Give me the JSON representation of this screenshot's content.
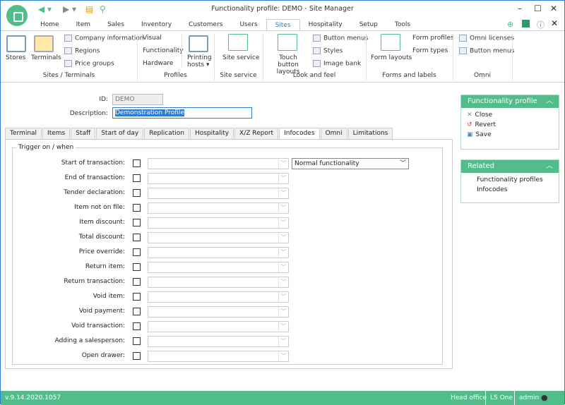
{
  "window": {
    "title": "Functionality profile: DEMO - Site Manager"
  },
  "menu_tabs": [
    "Home",
    "Item",
    "Sales",
    "Inventory",
    "Customers",
    "Users",
    "Sites",
    "Hospitality",
    "Setup",
    "Tools"
  ],
  "active_tab": "Sites",
  "ribbon": {
    "sites_terminals": {
      "label": "Sites / Terminals",
      "stores": "Stores",
      "terminals": "Terminals",
      "company": "Company information",
      "regions": "Regions",
      "price_groups": "Price groups"
    },
    "profiles": {
      "label": "Profiles",
      "visual": "Visual",
      "functionality": "Functionality",
      "hardware": "Hardware",
      "printing_hosts": "Printing hosts"
    },
    "site_service": {
      "label": "Site service",
      "site_service": "Site service"
    },
    "look_feel": {
      "label": "Look and feel",
      "touch": "Touch button layouts",
      "button_menus": "Button menus",
      "styles": "Styles",
      "image_bank": "Image bank"
    },
    "forms": {
      "label": "Forms and labels",
      "form_layouts": "Form layouts",
      "form_profiles": "Form profiles",
      "form_types": "Form types"
    },
    "omni": {
      "label": "Omni",
      "licenses": "Omni licenses",
      "button_menus": "Button menus"
    }
  },
  "form": {
    "id_label": "ID:",
    "id_value": "DEMO",
    "desc_label": "Description:",
    "desc_value": "Demonstration Profile"
  },
  "page_tabs": [
    "Terminal",
    "Items",
    "Staff",
    "Start of day",
    "Replication",
    "Hospitality",
    "X/Z Report",
    "Infocodes",
    "Omni",
    "Limitations"
  ],
  "active_page_tab": "Infocodes",
  "group_title": "Trigger on / when",
  "triggers": [
    "Start of transaction:",
    "End of transaction:",
    "Tender declaration:",
    "Item not on file:",
    "Item discount:",
    "Total discount:",
    "Price override:",
    "Return item:",
    "Return transaction:",
    "Void item:",
    "Void payment:",
    "Void transaction:",
    "Adding a salesperson:",
    "Open drawer:"
  ],
  "start_mode": "Normal functionality",
  "side": {
    "profile_title": "Functionality profile",
    "close": "Close",
    "revert": "Revert",
    "save": "Save",
    "related_title": "Related",
    "related": [
      "Functionality profiles",
      "Infocodes"
    ]
  },
  "status": {
    "version": "v.9.14.2020.1057",
    "site": "Head office",
    "product": "LS One",
    "user": "admin"
  },
  "colors": {
    "accent": "#52bd8a",
    "tab_active": "#2b7cd3"
  }
}
